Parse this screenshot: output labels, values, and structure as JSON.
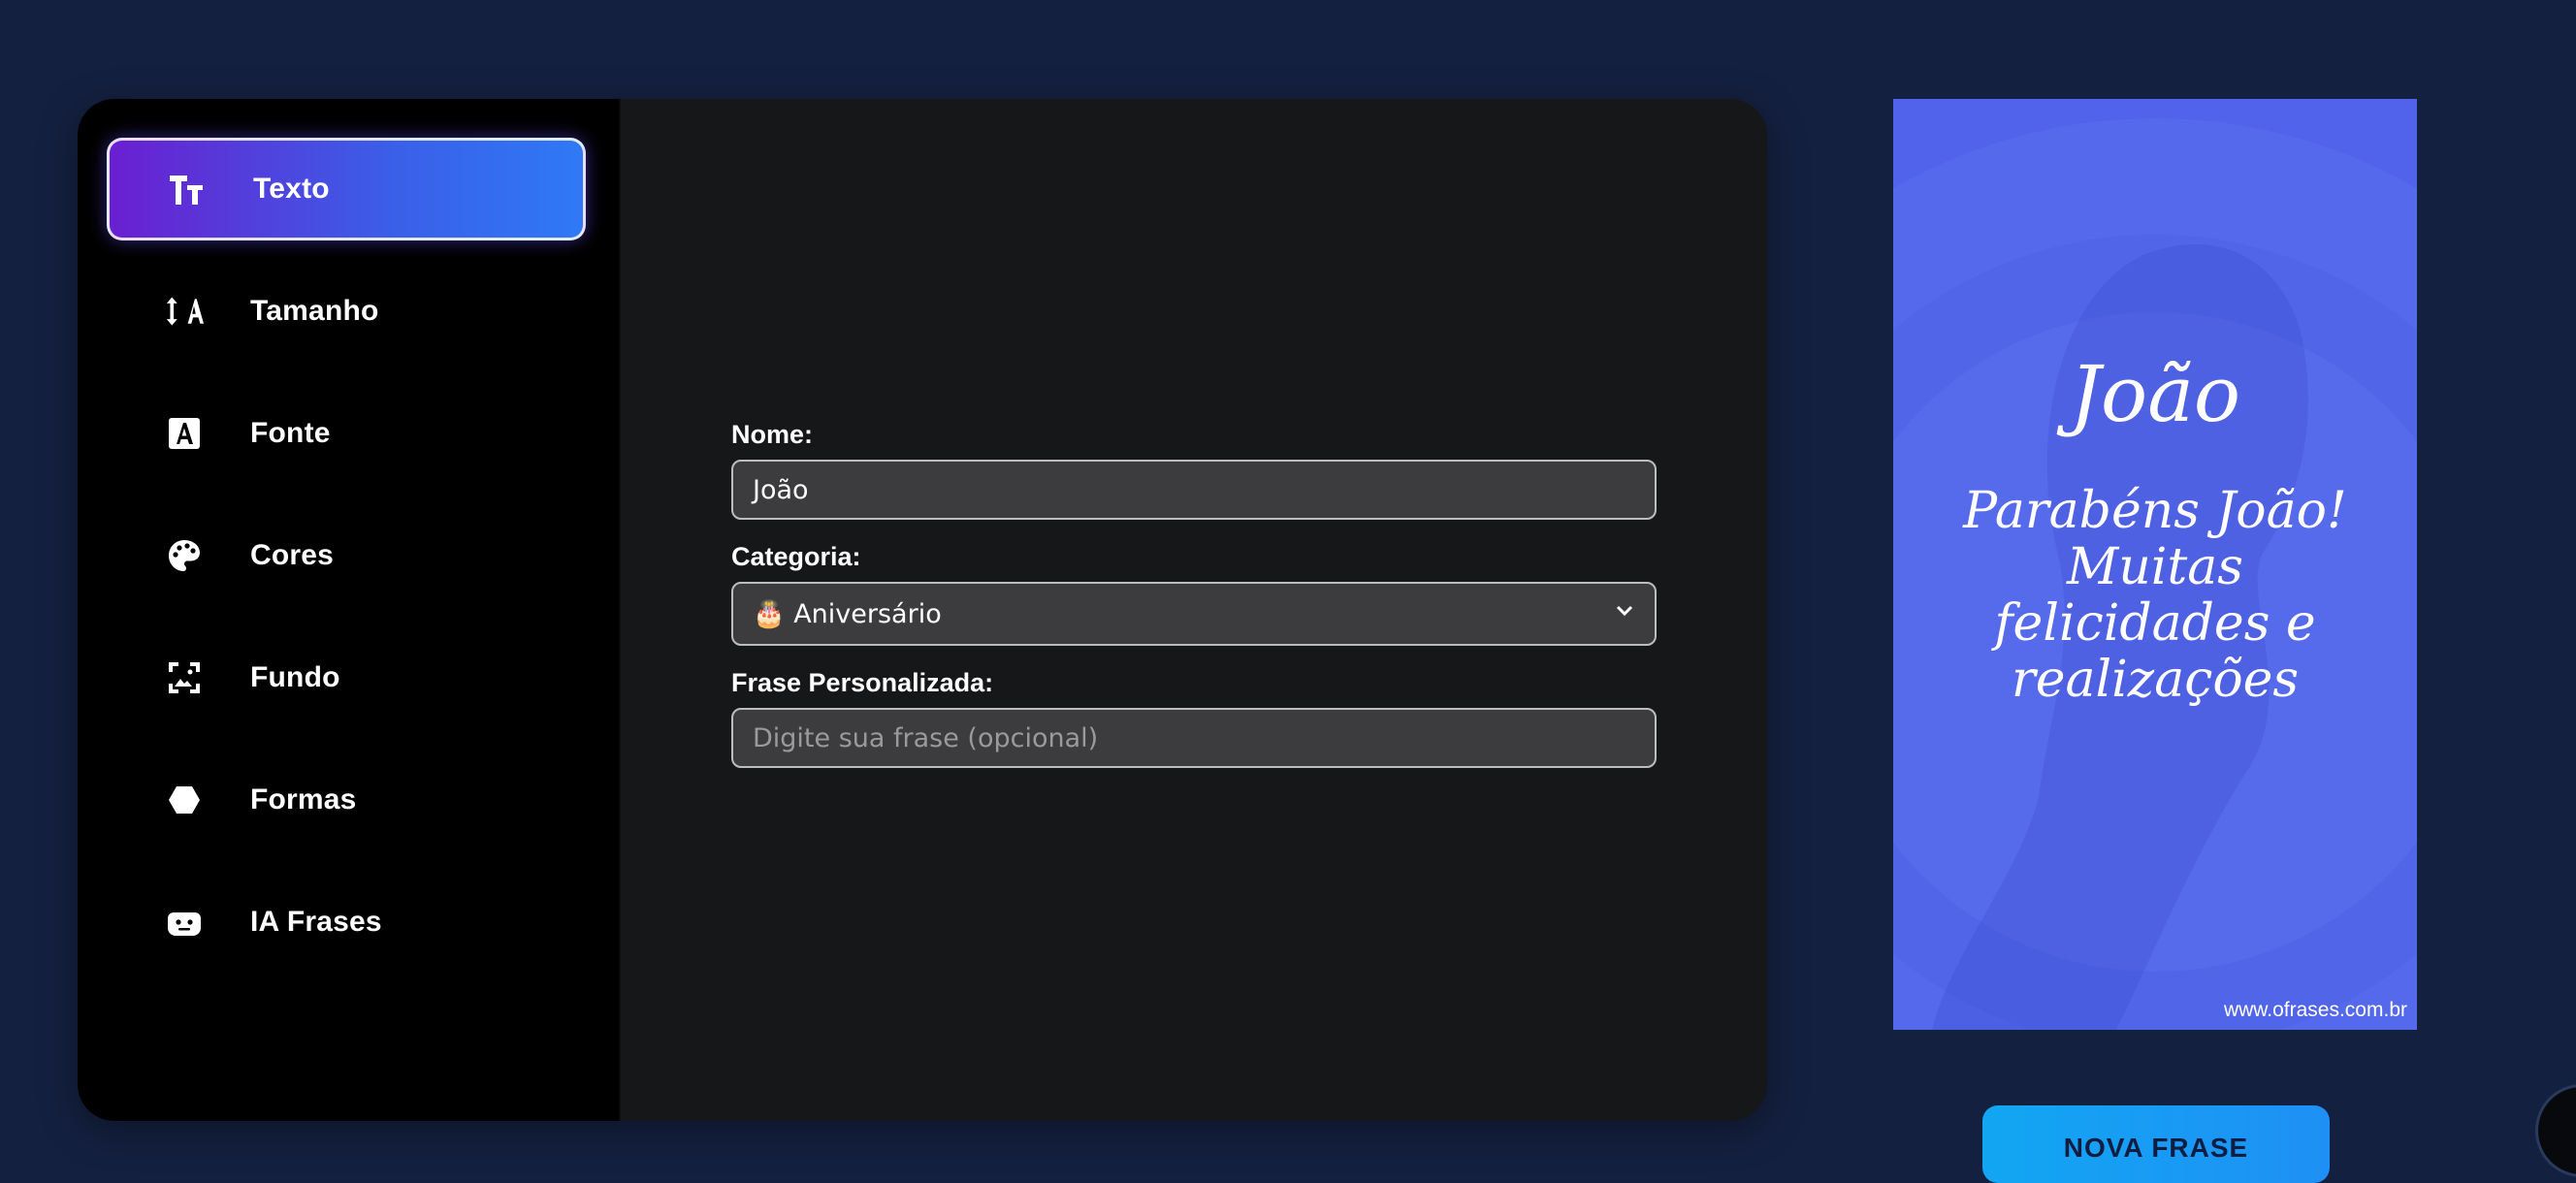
{
  "sidebar": {
    "items": [
      {
        "label": "Texto",
        "icon": "text-size-icon",
        "active": true
      },
      {
        "label": "Tamanho",
        "icon": "resize-text-icon",
        "active": false
      },
      {
        "label": "Fonte",
        "icon": "font-icon",
        "active": false
      },
      {
        "label": "Cores",
        "icon": "palette-icon",
        "active": false
      },
      {
        "label": "Fundo",
        "icon": "image-frame-icon",
        "active": false
      },
      {
        "label": "Formas",
        "icon": "hexagon-icon",
        "active": false
      },
      {
        "label": "IA Frases",
        "icon": "robot-icon",
        "active": false
      }
    ]
  },
  "form": {
    "name_label": "Nome:",
    "name_value": "João",
    "category_label": "Categoria:",
    "category_value": "🎂 Aniversário",
    "phrase_label": "Frase Personalizada:",
    "phrase_placeholder": "Digite sua frase (opcional)"
  },
  "preview": {
    "name": "João",
    "message_lines": [
      "Parabéns João!",
      "Muitas",
      "felicidades e",
      "realizações"
    ],
    "watermark": "www.ofrases.com.br",
    "background_color": "#5163ea"
  },
  "actions": {
    "new_phrase_label": "NOVA FRASE"
  },
  "colors": {
    "page_bg": "#14203f",
    "accent_gradient_start": "#6a1fd0",
    "accent_gradient_end": "#2f79f6",
    "button_blue": "#12a6f2"
  }
}
